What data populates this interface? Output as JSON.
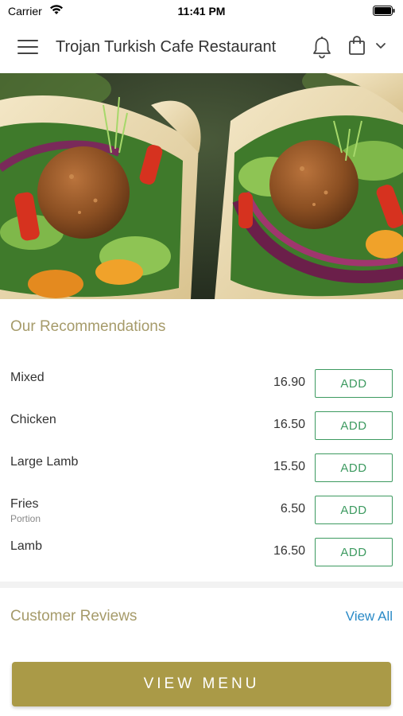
{
  "status_bar": {
    "carrier": "Carrier",
    "time": "11:41 PM"
  },
  "header": {
    "title": "Trojan Turkish Cafe Restaurant",
    "icons": [
      "menu-icon",
      "bell-icon",
      "shopping-bag-icon",
      "chevron-down-icon"
    ]
  },
  "hero": {
    "image": "falafel wraps with lettuce, tomato and red onion"
  },
  "recommendations": {
    "title": "Our Recommendations",
    "add_label": "ADD",
    "items": [
      {
        "name": "Mixed",
        "subtitle": "",
        "price": "16.90"
      },
      {
        "name": "Chicken",
        "subtitle": "",
        "price": "16.50"
      },
      {
        "name": "Large Lamb",
        "subtitle": "",
        "price": "15.50"
      },
      {
        "name": "Fries",
        "subtitle": "Portion",
        "price": "6.50"
      },
      {
        "name": "Lamb",
        "subtitle": "",
        "price": "16.50"
      }
    ]
  },
  "reviews": {
    "title": "Customer Reviews",
    "view_all": "View All"
  },
  "footer": {
    "view_menu": "VIEW MENU"
  },
  "colors": {
    "accent_gold": "#aa9a47",
    "section_title": "#a69b6a",
    "add_green": "#3d9a60",
    "link_blue": "#2a8ac7"
  }
}
